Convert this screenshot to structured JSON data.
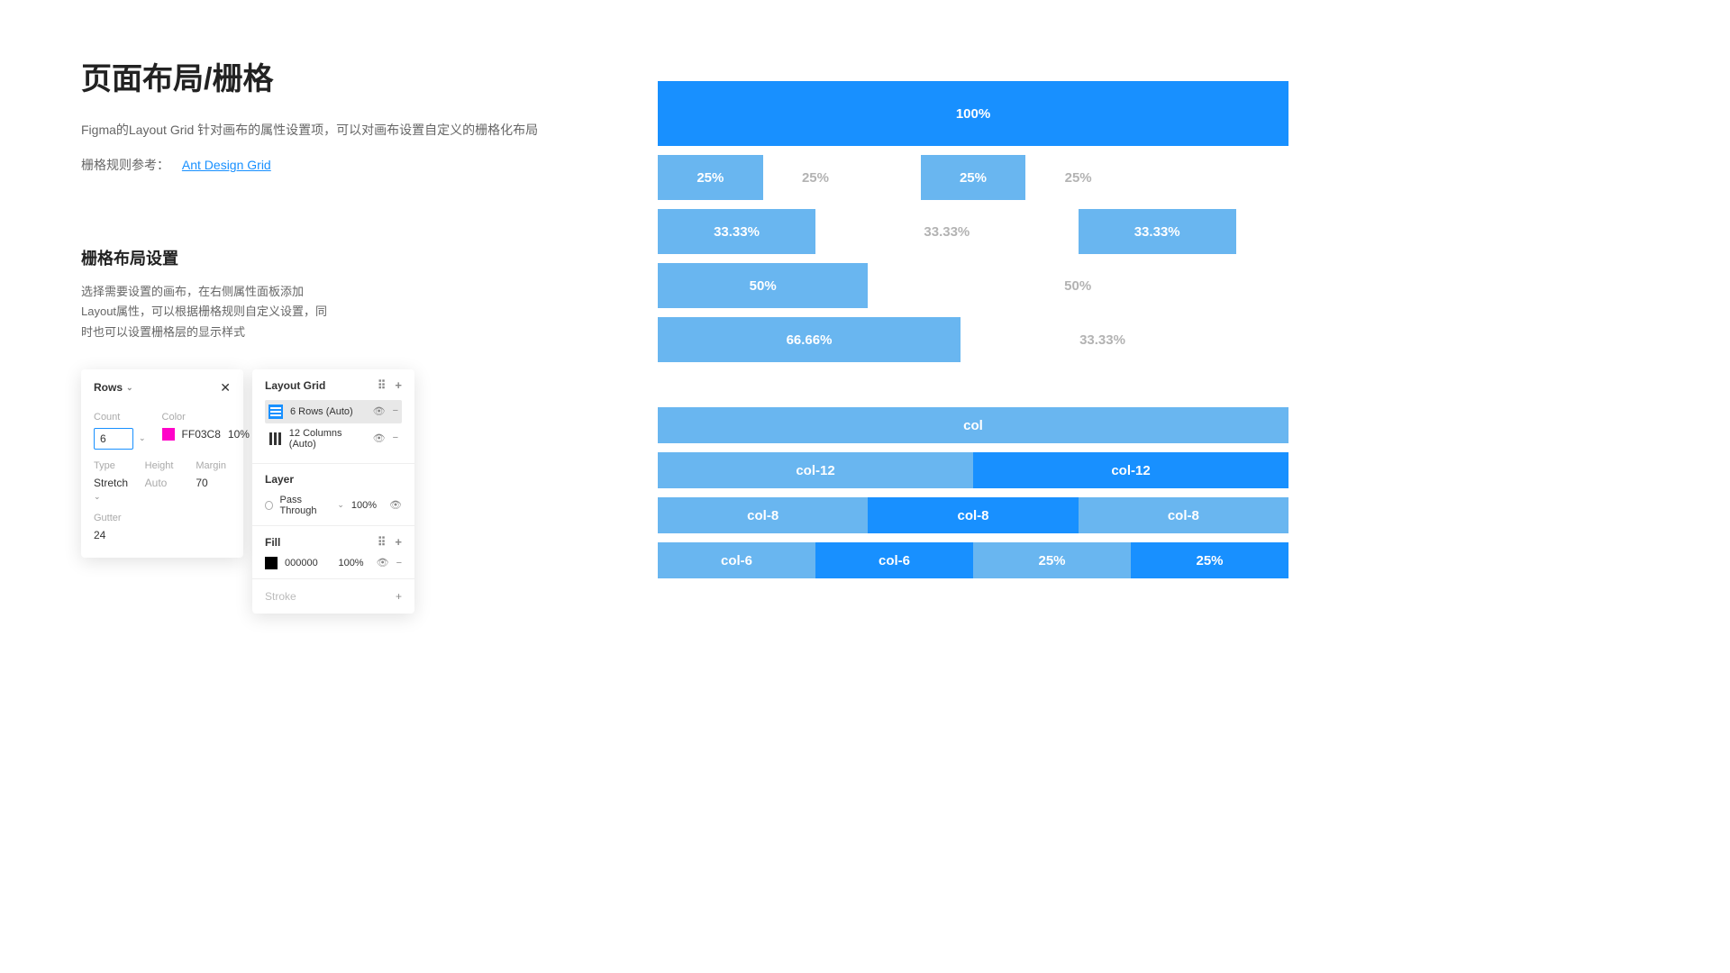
{
  "header": {
    "title": "页面布局/栅格",
    "desc": "Figma的Layout Grid 针对画布的属性设置项，可以对画布设置自定义的栅格化布局",
    "ref_label": "栅格规则参考：",
    "ref_link": "Ant Design Grid"
  },
  "section": {
    "title": "栅格布局设置",
    "desc": "选择需要设置的画布，在右侧属性面板添加Layout属性，可以根据栅格规则自定义设置，同时也可以设置栅格层的显示样式"
  },
  "panel_a": {
    "header": "Rows",
    "count_label": "Count",
    "count_value": "6",
    "color_label": "Color",
    "color_hex": "FF03C8",
    "color_opacity": "10%",
    "type_label": "Type",
    "type_value": "Stretch",
    "height_label": "Height",
    "height_value": "Auto",
    "margin_label": "Margin",
    "margin_value": "70",
    "gutter_label": "Gutter",
    "gutter_value": "24"
  },
  "panel_b": {
    "layout_grid_label": "Layout Grid",
    "rows_item": "6 Rows (Auto)",
    "cols_item": "12 Columns (Auto)",
    "layer_label": "Layer",
    "layer_mode": "Pass Through",
    "layer_opacity": "100%",
    "fill_label": "Fill",
    "fill_hex": "000000",
    "fill_opacity": "100%",
    "stroke_label": "Stroke"
  },
  "grid_demo": {
    "row1": [
      "100%"
    ],
    "row2": [
      "25%",
      "25%",
      "25%",
      "25%"
    ],
    "row3": [
      "33.33%",
      "33.33%",
      "33.33%"
    ],
    "row4": [
      "50%",
      "50%"
    ],
    "row5": [
      "66.66%",
      "33.33%"
    ],
    "row6": [
      "col"
    ],
    "row7": [
      "col-12",
      "col-12"
    ],
    "row8": [
      "col-8",
      "col-8",
      "col-8"
    ],
    "row9": [
      "col-6",
      "col-6",
      "25%",
      "25%"
    ]
  }
}
